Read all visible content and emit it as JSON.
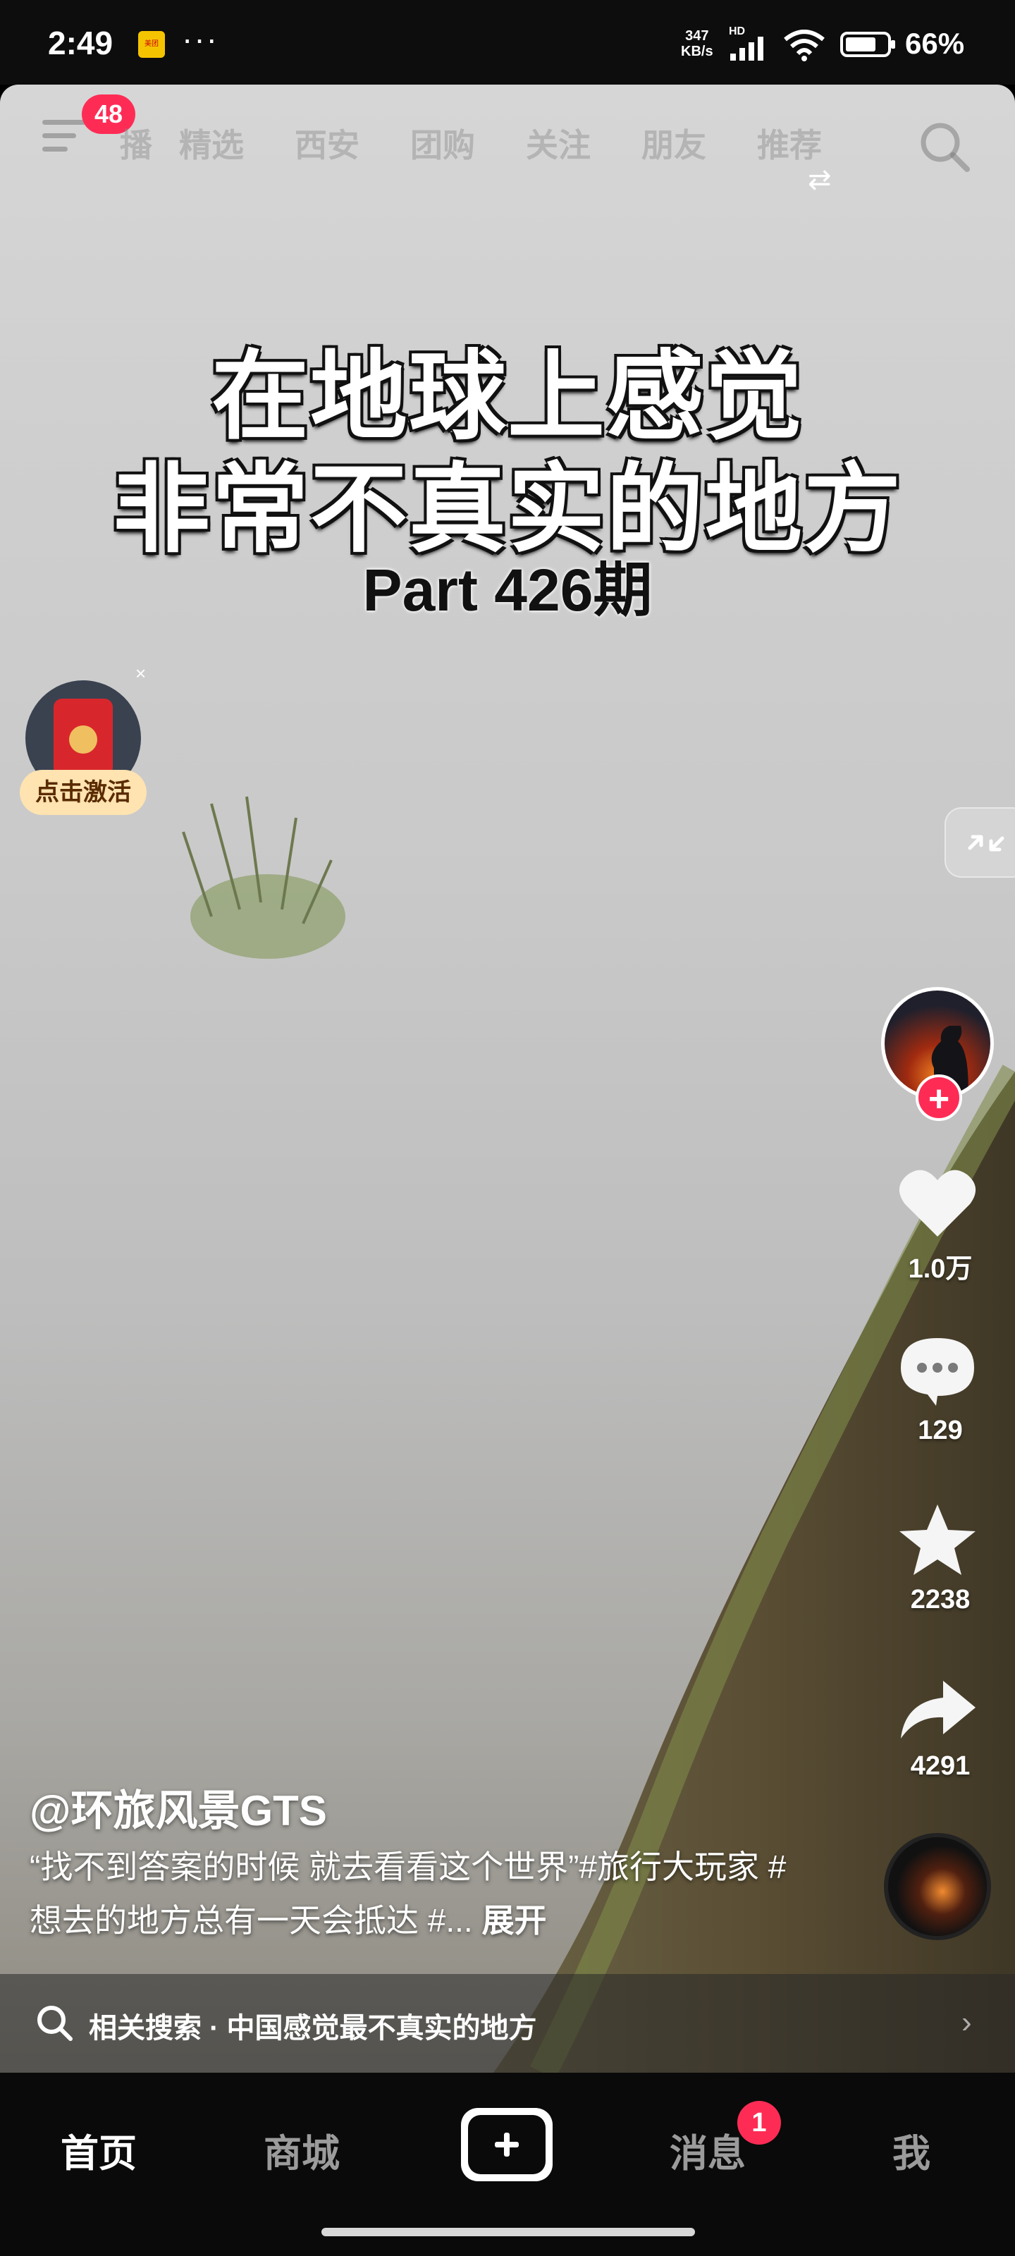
{
  "status_bar": {
    "time": "2:49",
    "app_badge": "美团",
    "overflow": "···",
    "speed_value": "347",
    "speed_unit": "KB/s",
    "network_label": "HD",
    "battery": "66%"
  },
  "top_nav": {
    "notification_count": "48",
    "tabs": [
      "播",
      "精选",
      "西安",
      "团购",
      "关注",
      "朋友",
      "推荐"
    ]
  },
  "video": {
    "title_line_1": "在地球上感觉",
    "title_line_2": "非常不真实的地方",
    "episode": "Part 426期"
  },
  "envelope_widget": {
    "label": "点击激活",
    "close": "×"
  },
  "right_rail": {
    "follow": "+",
    "likes": "1.0万",
    "comments": "129",
    "favorites": "2238",
    "shares": "4291"
  },
  "caption": {
    "author": "@环旅风景GTS",
    "text": "“找不到答案的时候 就去看看这个世界”#旅行大玩家 #想去的地方总有一天会抵达 #...",
    "expand": "展开"
  },
  "related_search": {
    "label": "相关搜索 · 中国感觉最不真实的地方",
    "chevron": "›"
  },
  "bottom_nav": {
    "home": "首页",
    "mall": "商城",
    "messages": "消息",
    "messages_badge": "1",
    "me": "我"
  },
  "colors": {
    "accent": "#fe2c55",
    "envelope_label_bg": "#ffe3b0"
  }
}
